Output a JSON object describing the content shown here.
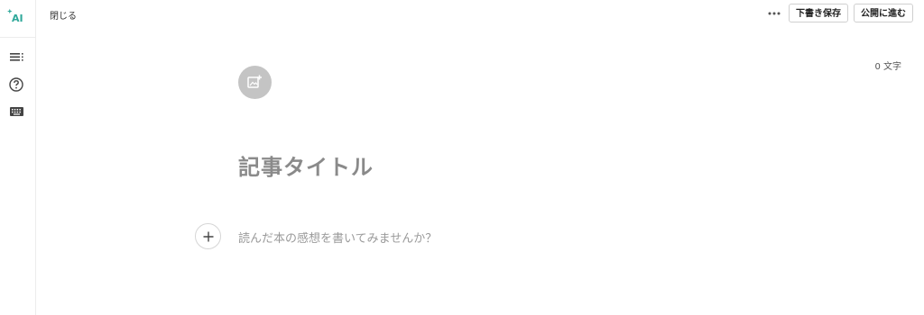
{
  "sidebar": {
    "ai_label": "AI",
    "items": [
      {
        "icon": "table-of-contents-icon"
      },
      {
        "icon": "help-icon"
      },
      {
        "icon": "keyboard-icon"
      }
    ]
  },
  "header": {
    "close_label": "閉じる",
    "more_icon": "more-dots-icon",
    "draft_label": "下書き保存",
    "publish_label": "公開に進む"
  },
  "editor": {
    "char_count": "0 文字",
    "title_placeholder": "記事タイトル",
    "body_placeholder": "読んだ本の感想を書いてみませんか？"
  },
  "colors": {
    "ai_accent": "#2fa89a",
    "image_button_bg": "#c4c4c4",
    "title_placeholder": "#8a8a8a",
    "body_placeholder": "#9a9a9a"
  }
}
